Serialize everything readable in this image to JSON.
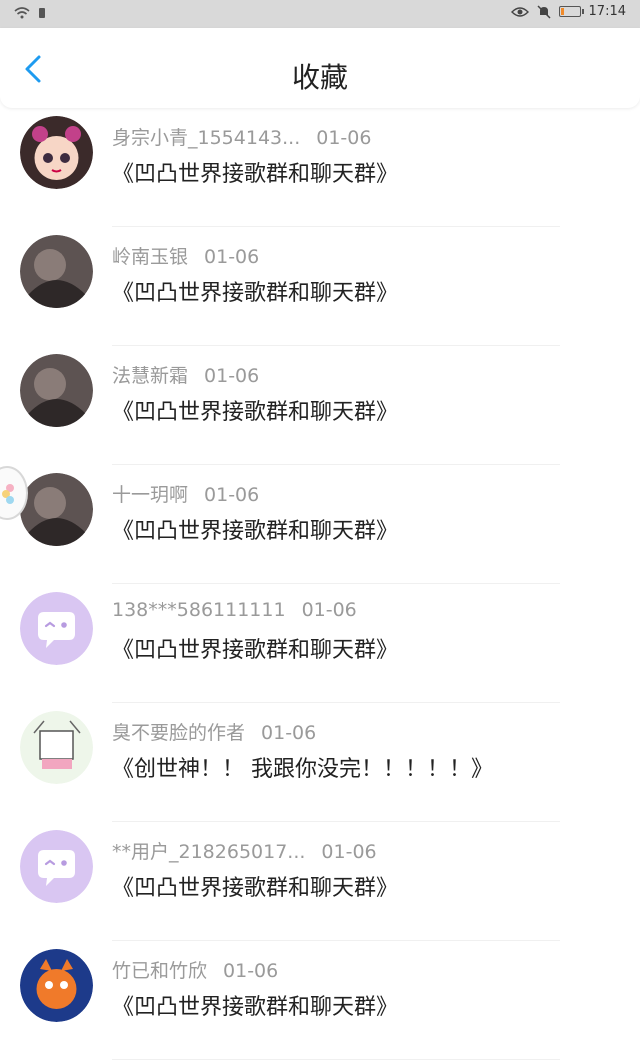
{
  "status_bar": {
    "time": "17:14",
    "icons": [
      "wifi-icon",
      "notification-icon",
      "eye-icon",
      "mute-icon",
      "battery-icon"
    ],
    "battery_level": 0.18
  },
  "header": {
    "title": "收藏",
    "back_icon": "chevron-left-icon"
  },
  "items": [
    {
      "author": "身宗小青_1554143...",
      "date": "01-06",
      "content": "《凹凸世界接歌群和聊天群》",
      "avatar": "anime-girl"
    },
    {
      "author": "岭南玉银",
      "date": "01-06",
      "content": "《凹凸世界接歌群和聊天群》",
      "avatar": "photo"
    },
    {
      "author": "法慧新霜",
      "date": "01-06",
      "content": "《凹凸世界接歌群和聊天群》",
      "avatar": "photo"
    },
    {
      "author": "十一玥啊",
      "date": "01-06",
      "content": "《凹凸世界接歌群和聊天群》",
      "avatar": "photo"
    },
    {
      "author": "138***586111111",
      "date": "01-06",
      "content": "《凹凸世界接歌群和聊天群》",
      "avatar": "default"
    },
    {
      "author": "臭不要脸的作者",
      "date": "01-06",
      "content": "《创世神！！ 我跟你没完！！！！！》",
      "avatar": "sketch"
    },
    {
      "author": "**用户_218265017...",
      "date": "01-06",
      "content": "《凹凸世界接歌群和聊天群》",
      "avatar": "default"
    },
    {
      "author": "竹已和竹欣",
      "date": "01-06",
      "content": "《凹凸世界接歌群和聊天群》",
      "avatar": "cartoon"
    }
  ],
  "colors": {
    "accent": "#1e9bf0",
    "default_avatar": "#d9c6f2"
  }
}
